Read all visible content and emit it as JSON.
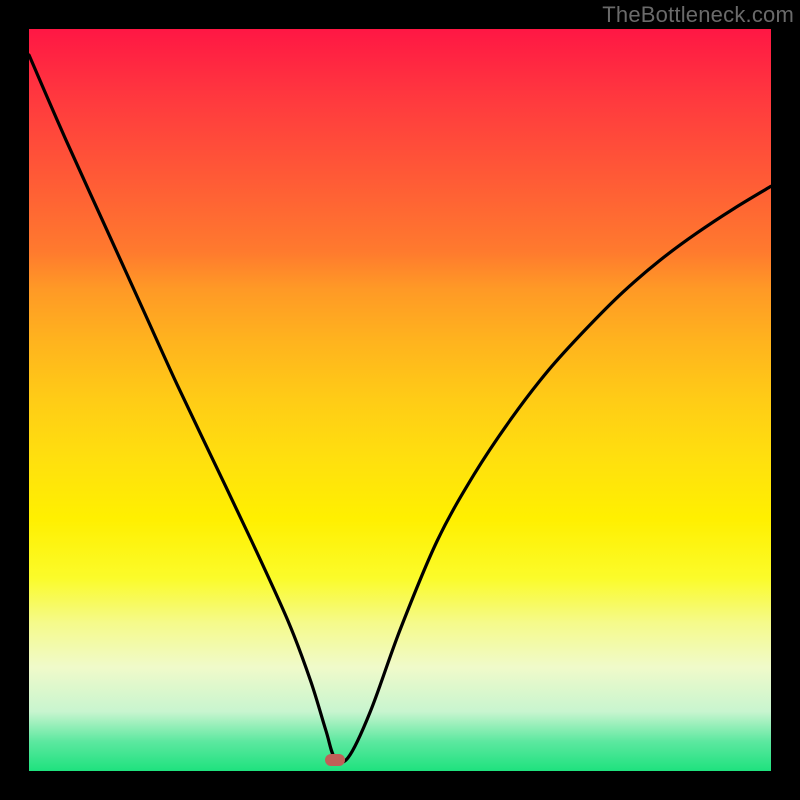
{
  "watermark": "TheBottleneck.com",
  "marker": {
    "x_frac": 0.412,
    "y_frac": 0.985
  },
  "chart_data": {
    "type": "line",
    "title": "",
    "xlabel": "",
    "ylabel": "",
    "xlim": [
      0,
      1
    ],
    "ylim": [
      0,
      1
    ],
    "grid": false,
    "legend": false,
    "series": [
      {
        "name": "bottleneck-curve",
        "x": [
          0.0,
          0.05,
          0.1,
          0.15,
          0.2,
          0.25,
          0.3,
          0.35,
          0.38,
          0.4,
          0.412,
          0.43,
          0.46,
          0.5,
          0.55,
          0.6,
          0.65,
          0.7,
          0.75,
          0.8,
          0.85,
          0.9,
          0.95,
          1.0
        ],
        "y": [
          0.965,
          0.85,
          0.74,
          0.63,
          0.52,
          0.415,
          0.31,
          0.2,
          0.12,
          0.055,
          0.018,
          0.018,
          0.08,
          0.19,
          0.31,
          0.4,
          0.475,
          0.54,
          0.595,
          0.645,
          0.688,
          0.725,
          0.758,
          0.788
        ]
      }
    ],
    "annotations": [
      {
        "type": "marker",
        "x": 0.412,
        "y": 0.015,
        "color": "#c06058"
      }
    ],
    "background_gradient": {
      "top": "#ff1744",
      "mid": "#ffe00e",
      "bottom": "#1ee27e"
    }
  }
}
